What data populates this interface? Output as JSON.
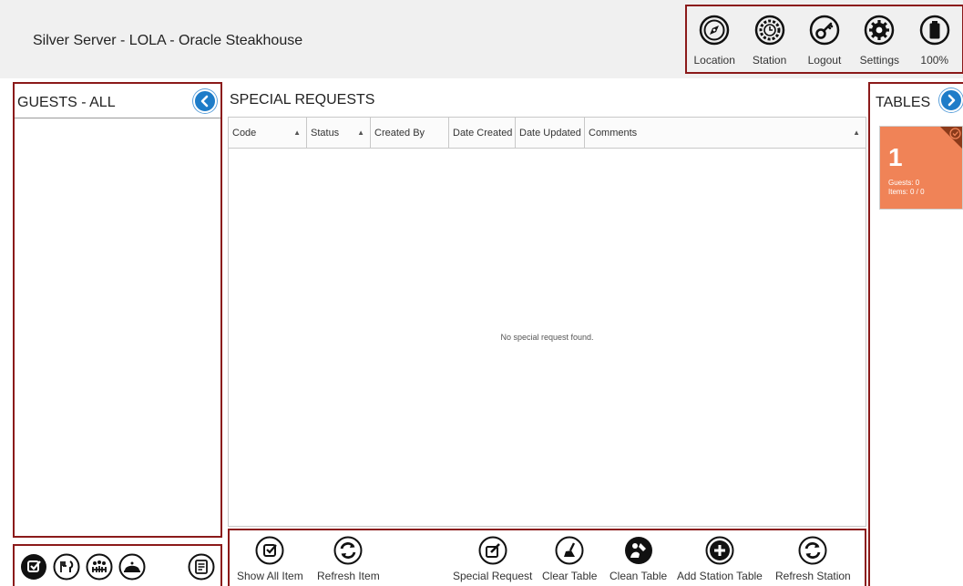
{
  "header": {
    "title": "Silver Server - LOLA - Oracle Steakhouse",
    "toolbar": [
      {
        "label": "Location",
        "icon": "compass-icon"
      },
      {
        "label": "Station",
        "icon": "station-clock-icon"
      },
      {
        "label": "Logout",
        "icon": "key-icon"
      },
      {
        "label": "Settings",
        "icon": "gear-icon"
      },
      {
        "label": "100%",
        "icon": "battery-icon"
      }
    ]
  },
  "guests": {
    "title": "GUESTS - ALL",
    "bar_icons": [
      "checkbox-icon",
      "fork-knife-icon",
      "group-dining-icon",
      "cloche-icon",
      "notes-icon"
    ]
  },
  "special_requests": {
    "title": "SPECIAL REQUESTS",
    "columns": [
      "Code",
      "Status",
      "Created By",
      "Date Created",
      "Date Updated",
      "Comments"
    ],
    "empty_message": "No special request found.",
    "actions": [
      {
        "label": "Show All Item",
        "icon": "checklist-icon"
      },
      {
        "label": "Refresh Item",
        "icon": "refresh-icon"
      },
      {
        "label": "Special Request",
        "icon": "edit-icon"
      },
      {
        "label": "Clear Table",
        "icon": "broom-icon"
      },
      {
        "label": "Clean Table",
        "icon": "cleaning-icon"
      },
      {
        "label": "Add Station Table",
        "icon": "plus-circle-icon"
      },
      {
        "label": "Refresh Station",
        "icon": "refresh-icon"
      }
    ]
  },
  "tables": {
    "title": "TABLES",
    "cards": [
      {
        "number": "1",
        "guests": "Guests: 0",
        "items": "Items: 0 / 0"
      }
    ]
  },
  "colors": {
    "accent_border": "#8b1a1a",
    "nav_blue": "#1e7cc8",
    "table_card": "#f08357"
  }
}
